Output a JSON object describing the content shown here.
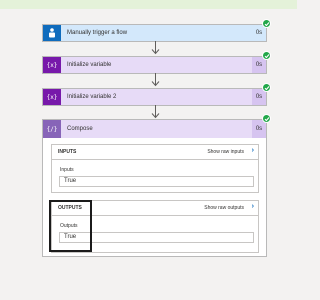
{
  "colors": {
    "trigger_bg": "#d3e8fb",
    "trigger_accent": "#0f6cbd",
    "variable_bg": "#e7dbf7",
    "variable_accent": "#7719aa",
    "compose_accent": "#8764b8",
    "success": "#22a84a"
  },
  "steps": [
    {
      "title": "Manually trigger a flow",
      "duration": "0s",
      "icon": "hand-pointer-icon"
    },
    {
      "title": "Initialize variable",
      "duration": "0s",
      "icon": "variable-icon"
    },
    {
      "title": "Initialize variable 2",
      "duration": "0s",
      "icon": "variable-icon"
    }
  ],
  "compose": {
    "title": "Compose",
    "duration": "0s",
    "icon": "compose-icon",
    "inputs": {
      "header": "INPUTS",
      "raw_link": "Show raw inputs",
      "field_label": "Inputs",
      "field_value": "True"
    },
    "outputs": {
      "header": "OUTPUTS",
      "raw_link": "Show raw outputs",
      "field_label": "Outputs",
      "field_value": "True"
    }
  }
}
